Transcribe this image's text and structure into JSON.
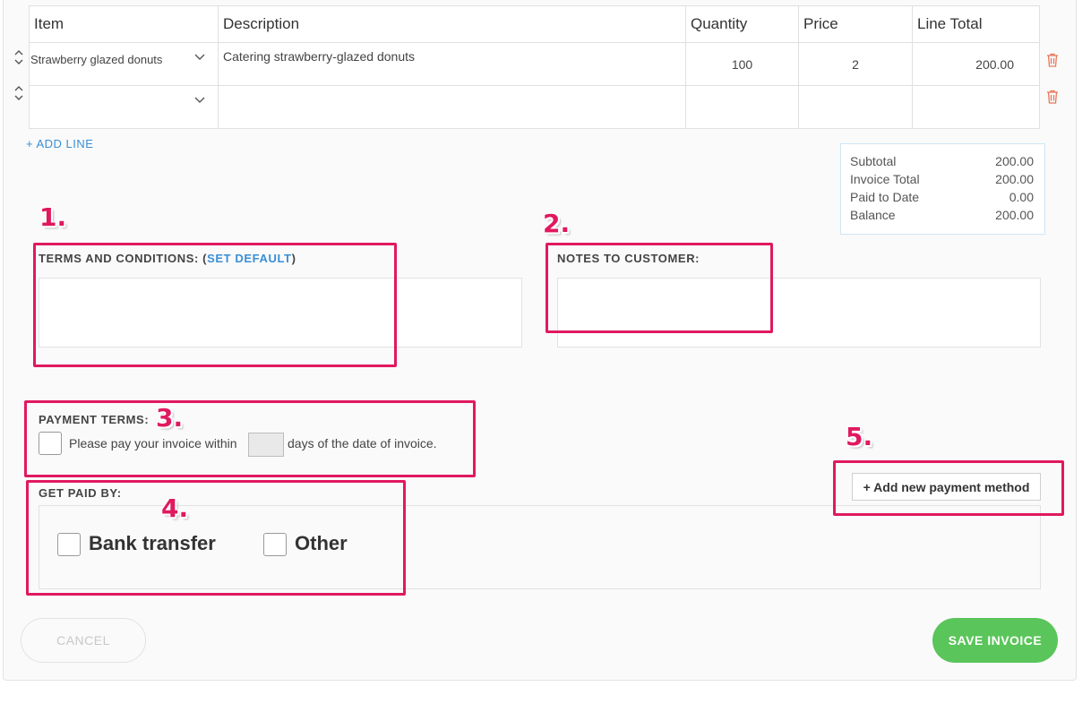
{
  "table": {
    "headers": [
      "Item",
      "Description",
      "Quantity",
      "Price",
      "Line Total"
    ],
    "rows": [
      {
        "item": "Strawberry glazed donuts",
        "description": "Catering strawberry-glazed donuts",
        "quantity": "100",
        "price": "2",
        "line_total": "200.00"
      },
      {
        "item": "",
        "description": "",
        "quantity": "",
        "price": "",
        "line_total": ""
      }
    ]
  },
  "add_line": "+ ADD LINE",
  "summary": [
    {
      "label": "Subtotal",
      "value": "200.00"
    },
    {
      "label": "Invoice Total",
      "value": "200.00"
    },
    {
      "label": "Paid to Date",
      "value": "0.00"
    },
    {
      "label": "Balance",
      "value": "200.00"
    }
  ],
  "terms": {
    "label_prefix": "TERMS AND CONDITIONS: (",
    "set_default": "SET DEFAULT",
    "label_suffix": ")",
    "value": ""
  },
  "notes": {
    "label": "NOTES TO CUSTOMER:",
    "value": ""
  },
  "payment_terms": {
    "label": "PAYMENT TERMS:",
    "text_before": "Please pay your invoice within",
    "days_value": "",
    "text_after": "days of the date of invoice."
  },
  "get_paid_by": {
    "label": "GET PAID BY:",
    "options": [
      "Bank transfer",
      "Other"
    ]
  },
  "add_payment_method": "+ Add new payment method",
  "buttons": {
    "cancel": "CANCEL",
    "save": "SAVE INVOICE"
  },
  "annotations": [
    "1.",
    "2.",
    "3.",
    "4.",
    "5."
  ],
  "colors": {
    "accent_blue": "#3a8fd6",
    "save_green": "#5ac55a",
    "highlight": "#e0195f",
    "trash_red": "#e8775a"
  }
}
